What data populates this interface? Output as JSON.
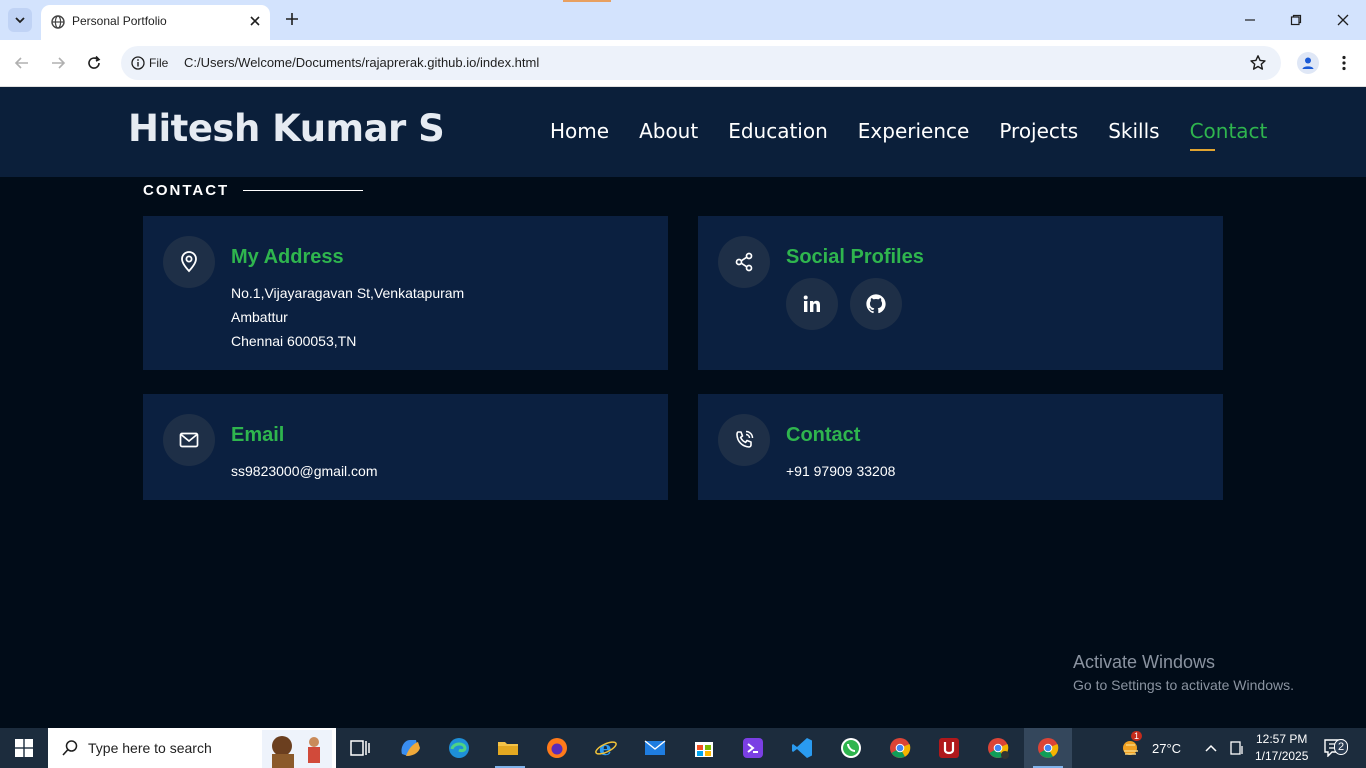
{
  "browser": {
    "tab_title": "Personal Portfolio",
    "chip_label": "File",
    "url": "C:/Users/Welcome/Documents/rajaprerak.github.io/index.html"
  },
  "site": {
    "logo": "Hitesh Kumar S",
    "nav": [
      "Home",
      "About",
      "Education",
      "Experience",
      "Projects",
      "Skills",
      "Contact"
    ],
    "active_nav": "Contact",
    "accent": "#2fb54e",
    "underline_color": "#e0a431"
  },
  "contact": {
    "section_label": "CONTACT",
    "address": {
      "title": "My Address",
      "lines": [
        "No.1,Vijayaragavan St,Venkatapuram",
        "Ambattur",
        "Chennai 600053,TN"
      ]
    },
    "social": {
      "title": "Social Profiles",
      "icons": [
        "linkedin-icon",
        "github-icon"
      ]
    },
    "email": {
      "title": "Email",
      "value": "ss9823000@gmail.com"
    },
    "phone": {
      "title": "Contact",
      "value": "+91 97909 33208"
    }
  },
  "watermark": {
    "line1": "Activate Windows",
    "line2": "Go to Settings to activate Windows."
  },
  "taskbar": {
    "search_placeholder": "Type here to search",
    "weather": "27°C",
    "time": "12:57 PM",
    "date": "1/17/2025",
    "notification_count": "2",
    "weather_badge": "1"
  }
}
